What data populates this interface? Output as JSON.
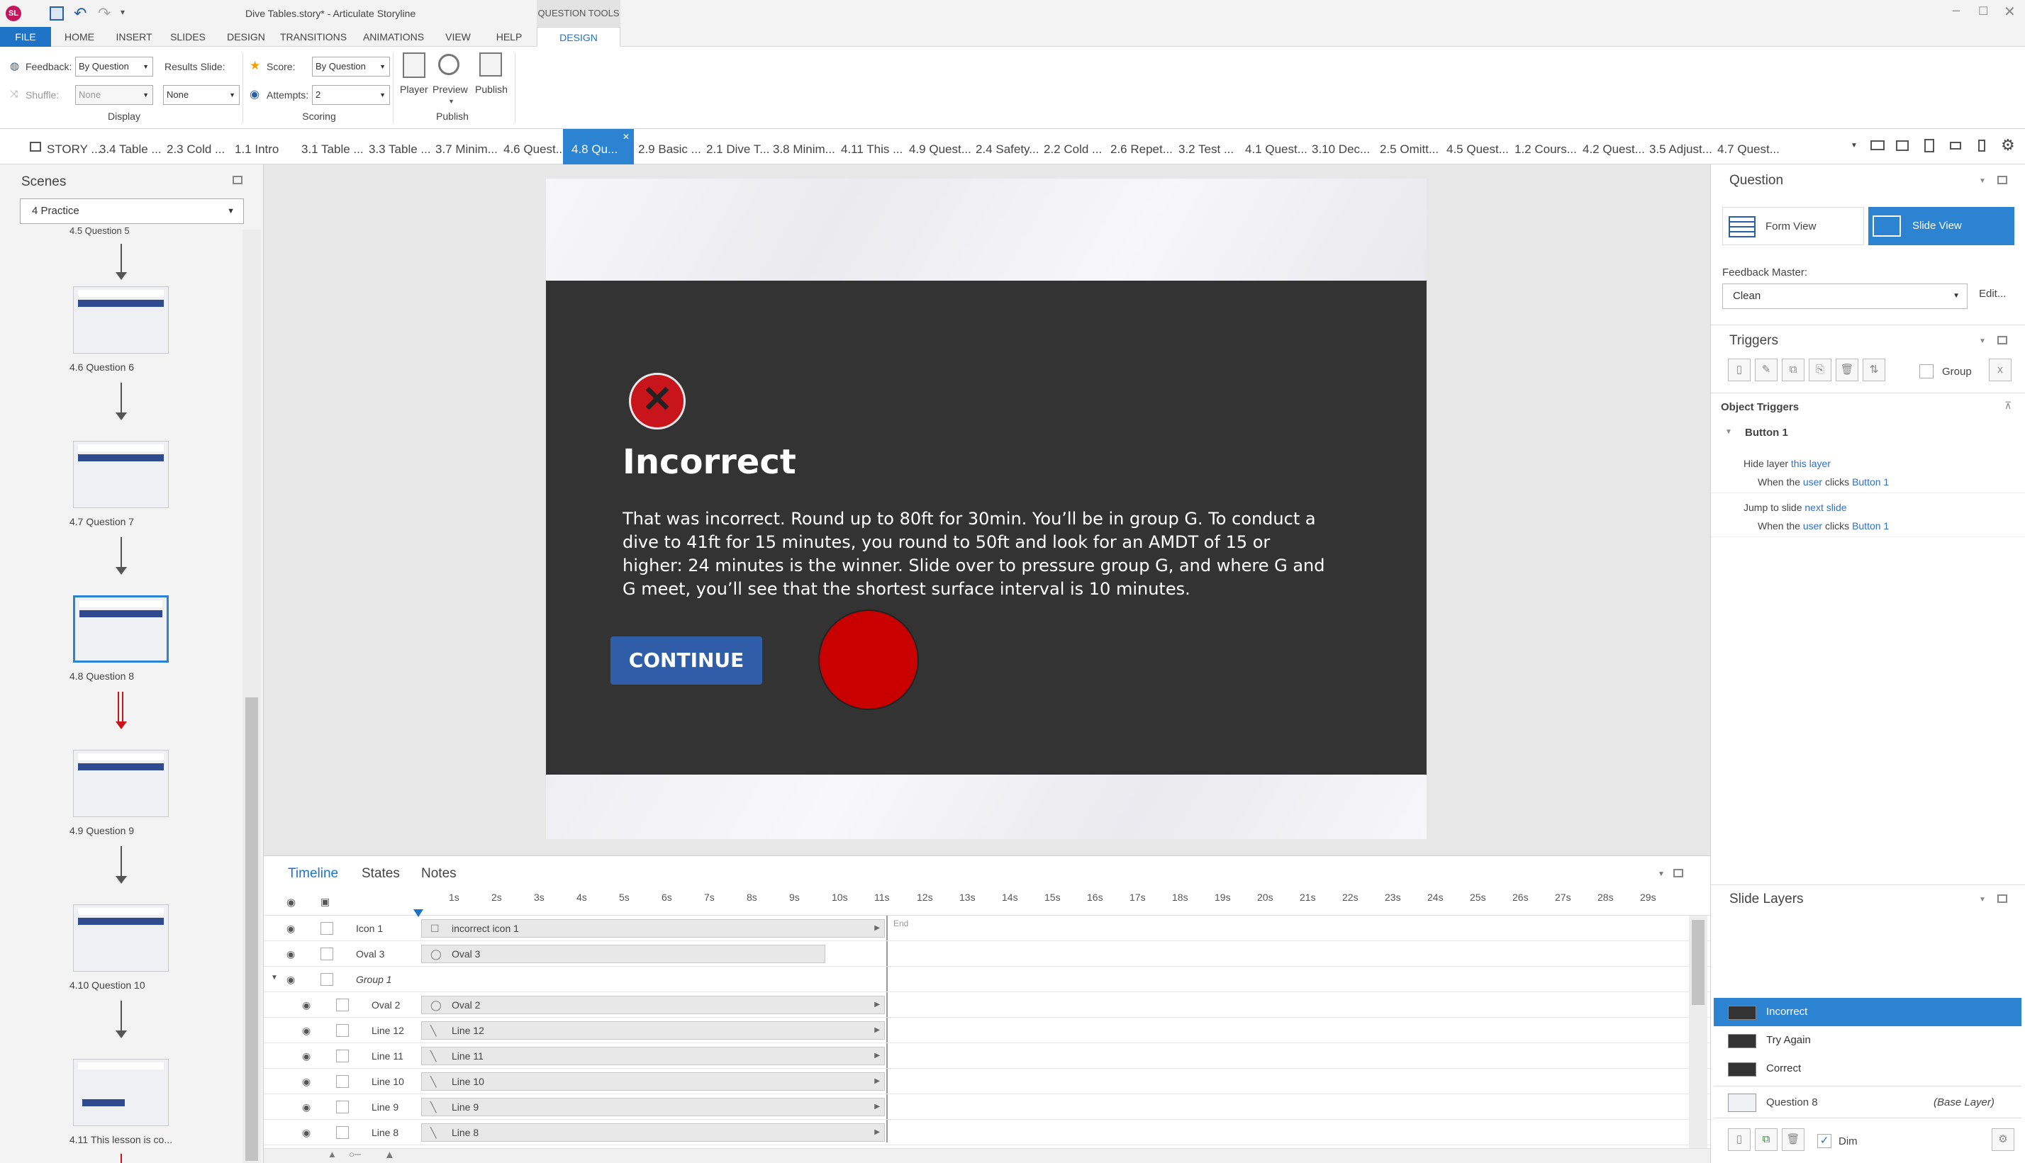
{
  "app": {
    "title": "Dive Tables.story* - Articulate Storyline",
    "contextual_label": "QUESTION TOOLS"
  },
  "ribbon_tabs": [
    "FILE",
    "HOME",
    "INSERT",
    "SLIDES",
    "DESIGN",
    "TRANSITIONS",
    "ANIMATIONS",
    "VIEW",
    "HELP",
    "DESIGN"
  ],
  "ribbon": {
    "feedback_label": "Feedback:",
    "feedback_value": "By Question",
    "shuffle_label": "Shuffle:",
    "shuffle_value": "None",
    "results_slide_label": "Results Slide:",
    "results_slide_value": "None",
    "display_group": "Display",
    "score_label": "Score:",
    "score_value": "By Question",
    "attempts_label": "Attempts:",
    "attempts_value": "2",
    "scoring_group": "Scoring",
    "player_label": "Player",
    "preview_label": "Preview",
    "publish_label": "Publish",
    "publish_group": "Publish"
  },
  "slide_tabs": [
    "STORY ...",
    "3.4 Table ...",
    "2.3 Cold ...",
    "1.1 Intro",
    "3.1 Table ...",
    "3.3 Table ...",
    "3.7 Minim...",
    "4.6 Quest...",
    "4.8 Qu...",
    "2.9 Basic ...",
    "2.1 Dive T...",
    "3.8 Minim...",
    "4.11 This ...",
    "4.9 Quest...",
    "2.4 Safety...",
    "2.2 Cold ...",
    "2.6 Repet...",
    "3.2 Test ...",
    "4.1 Quest...",
    "3.10 Dec...",
    "2.5 Omitt...",
    "4.5 Quest...",
    "1.2 Cours...",
    "4.2 Quest...",
    "3.5 Adjust...",
    "4.7 Quest..."
  ],
  "scenes": {
    "title": "Scenes",
    "selected": "4 Practice",
    "top_label": "4.5 Question 5",
    "thumbs": [
      {
        "label": "4.6 Question 6",
        "variant": "plain"
      },
      {
        "label": "4.7 Question 7",
        "variant": "plain"
      },
      {
        "label": "4.8 Question 8",
        "variant": "selected"
      },
      {
        "label": "4.9 Question 9",
        "variant": "plain"
      },
      {
        "label": "4.10 Question 10",
        "variant": "plain"
      },
      {
        "label": "4.11 This lesson is co...",
        "variant": "lesson"
      }
    ]
  },
  "feedback": {
    "heading": "Incorrect",
    "body": "That was incorrect.  Round up to 80ft for 30min.  You’ll be in group G.  To conduct a dive to 41ft for 15 minutes, you round to 50ft and look for an AMDT of 15 or higher: 24 minutes is the winner.  Slide over to pressure group G, and where G and G meet, you’ll see that the shortest surface interval is 10 minutes.",
    "button": "CONTINUE"
  },
  "timeline": {
    "tabs": [
      "Timeline",
      "States",
      "Notes"
    ],
    "ticks": [
      "1s",
      "2s",
      "3s",
      "4s",
      "5s",
      "6s",
      "7s",
      "8s",
      "9s",
      "10s",
      "11s",
      "12s",
      "13s",
      "14s",
      "15s",
      "16s",
      "17s",
      "18s",
      "19s",
      "20s",
      "21s",
      "22s",
      "23s",
      "24s",
      "25s",
      "26s",
      "27s",
      "28s",
      "29s"
    ],
    "end_label": "End",
    "rows": [
      {
        "name": "Icon 1",
        "bar": "incorrect icon 1",
        "glyph": "☐",
        "indent": false
      },
      {
        "name": "Oval 3",
        "bar": "Oval 3",
        "glyph": "◯",
        "indent": false
      },
      {
        "name": "Group 1",
        "bar": "",
        "glyph": "",
        "indent": false,
        "group": true
      },
      {
        "name": "Oval 2",
        "bar": "Oval 2",
        "glyph": "◯",
        "indent": true
      },
      {
        "name": "Line 12",
        "bar": "Line 12",
        "glyph": "╲",
        "indent": true
      },
      {
        "name": "Line 11",
        "bar": "Line 11",
        "glyph": "╲",
        "indent": true
      },
      {
        "name": "Line 10",
        "bar": "Line 10",
        "glyph": "╲",
        "indent": true
      },
      {
        "name": "Line 9",
        "bar": "Line 9",
        "glyph": "╲",
        "indent": true
      },
      {
        "name": "Line 8",
        "bar": "Line 8",
        "glyph": "╲",
        "indent": true
      }
    ]
  },
  "question_panel": {
    "title": "Question",
    "form_view": "Form View",
    "slide_view": "Slide View",
    "feedback_master_label": "Feedback Master:",
    "feedback_master_value": "Clean",
    "edit_label": "Edit..."
  },
  "triggers": {
    "title": "Triggers",
    "group_label": "Group",
    "object_triggers": "Object Triggers",
    "object": "Button 1",
    "items": [
      {
        "action": "Hide layer",
        "target": "this layer",
        "when": "When the",
        "who": "user",
        "event": "clicks",
        "obj": "Button 1"
      },
      {
        "action": "Jump to slide",
        "target": "next slide",
        "when": "When the",
        "who": "user",
        "event": "clicks",
        "obj": "Button 1"
      }
    ]
  },
  "slide_layers": {
    "title": "Slide Layers",
    "layers": [
      "Incorrect",
      "Try Again",
      "Correct"
    ],
    "base_layer": "Question 8",
    "base_tag": "(Base Layer)",
    "dim_label": "Dim"
  },
  "colors": {
    "accent": "#2b83d1",
    "button_blue": "#2f5da8",
    "incorrect_red": "#c8141b",
    "dark_panel": "#333333"
  }
}
